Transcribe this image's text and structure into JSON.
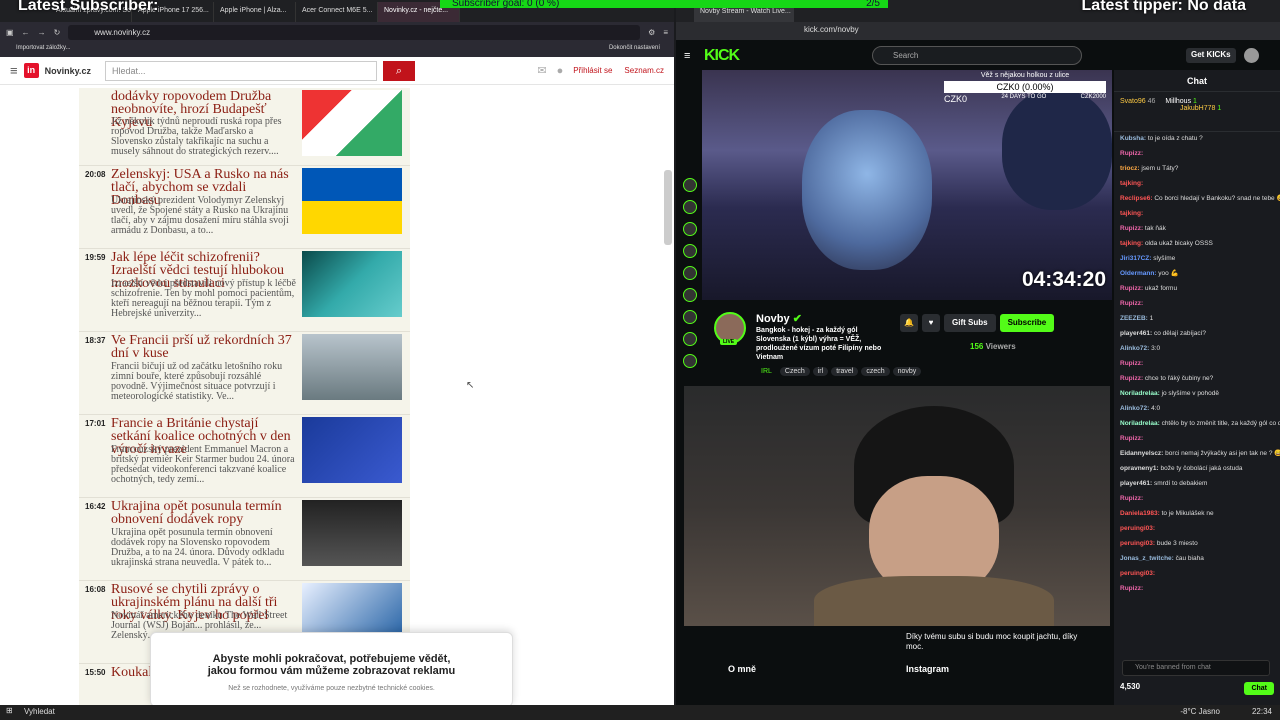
{
  "overlay": {
    "left": "Latest Subscriber:",
    "right": "Latest tipper: No data",
    "goal_text": "Subscriber goal:",
    "goal_pct": "0 (0 %)",
    "goal_count": "2/5"
  },
  "left_browser": {
    "tabs": [
      "Aktuální zprávy.com: Soul...",
      "Apple iPhone 17 256...",
      "Apple iPhone | Alza...",
      "Acer Connect M6E 5...",
      "Novinky.cz - nejčte..."
    ],
    "url": "www.novinky.cz",
    "bookmark": "Importovat záložky...",
    "bookmark_right": "Dokončit nastavení",
    "site": {
      "name": "Novinky.cz",
      "search_placeholder": "Hledat...",
      "login": "Přihlásit se",
      "brand": "Seznam.cz"
    },
    "articles": [
      {
        "time": "",
        "title": "dodávky ropovodem Družba neobnovíte, hrozí Budapešť Kyjevu",
        "perex": "Již několik týdnů neproudí ruská ropa přes ropovod Družba, takže Maďarsko a Slovensko zůstaly takřikajíc na suchu a musely sáhnout do strategických rezerv...."
      },
      {
        "time": "20:08",
        "title": "Zelenskyj: USA a Rusko na nás tlačí, abychom se vzdali Donbasu",
        "perex": "Ukrajinský prezident Volodymyr Zelenskyj uvedl, že Spojené státy a Rusko na Ukrajinu tlačí, aby v zájmu dosažení míru stáhla svoji armádu z Donbasu, a to..."
      },
      {
        "time": "19:59",
        "title": "Jak lépe léčit schizofrenii? Izraelští vědci testují hlubokou mozkovou stimulaci",
        "perex": "Izraelští vědci představili nový přístup k léčbě schizofrenie. Ten by mohl pomoci pacientům, kteří nereagují na běžnou terapii. Tým z Hebrejské univerzity..."
      },
      {
        "time": "18:37",
        "title": "Ve Francii prší už rekordních 37 dní v kuse",
        "perex": "Francii bičují už od začátku letošního roku zimní bouře, které způsobují rozsáhlé povodně. Výjimečnost situace potvrzují i meteorologické statistiky. Ve..."
      },
      {
        "time": "17:01",
        "title": "Francie a Británie chystají setkání koalice ochotných v den výročí invaze",
        "perex": "Francouzský prezident Emmanuel Macron a britský premiér Keir Starmer budou 24. února předsedat videokonferenci takzvané koalice ochotných, tedy zemí..."
      },
      {
        "time": "16:42",
        "title": "Ukrajina opět posunula termín obnovení dodávek ropy",
        "perex": "Ukrajina opět posunula termín obnovení dodávek ropy na Slovensko ropovodem Družba, a to na 24. února. Důvody odkladu ukrajinská strana neuvedla. V pátek to..."
      },
      {
        "time": "16:08",
        "title": "Rusové se chytili zprávy o ukrajinském plánu na další tři roky války. Kyjev ho popřel",
        "perex": "Novinář amerického deníku The Wall Street Journal (WSJ) Bojan... prohlásil, že... Zelenský..."
      },
      {
        "time": "15:50",
        "title": "Koukali n... zlomeni...",
        "perex": ""
      }
    ],
    "consent": {
      "main": "Abyste mohli pokračovat, potřebujeme vědět, jakou formou vám můžeme zobrazovat reklamu",
      "sub": "Než se rozhodnete, využíváme pouze nezbytné technické cookies."
    }
  },
  "right_browser": {
    "tab": "Novby Stream - Watch Live...",
    "url": "kick.com/novby",
    "kick": {
      "logo": "KICK",
      "search_placeholder": "Search",
      "get_kicks": "Get KICKs"
    },
    "video": {
      "goal_title": "Věž s nějakou holkou z ulice",
      "goal_value": "CZK0 (0.00%)",
      "goal_left": "CZK0",
      "goal_days": "24 DAYS TO GO",
      "goal_right": "CZK2000",
      "timer": "04:34:20"
    },
    "channel": {
      "name": "Novby",
      "title": "Bangkok - hokej - za každý gól Slovenska (1 kýbl) výhra = VĚŽ, prodloužené vízum poté Filipíny nebo Vietnam",
      "category": "IRL",
      "tags": [
        "Czech",
        "irl",
        "travel",
        "czech",
        "novby"
      ],
      "viewers": "156",
      "viewers_label": "Viewers",
      "gift_subs": "Gift Subs",
      "subscribe": "Subscribe",
      "live": "LIVE"
    },
    "below": {
      "quote": "Díky tvému subu si budu moc koupit jachtu, díky moc.",
      "about": "O mně",
      "instagram": "Instagram"
    },
    "chat": {
      "header": "Chat",
      "pinned": {
        "user1": "Svato96",
        "val1": "46",
        "user2": "Millhous",
        "val2": "1",
        "user3": "JakubH778",
        "val3": "1"
      },
      "messages": [
        {
          "user": "Kubsha:",
          "text": "to je oída z chatu ?",
          "color": "#9bd"
        },
        {
          "user": "Rupizz:",
          "text": "",
          "color": "#e6a"
        },
        {
          "user": "triocz:",
          "text": "jsem u Táty?",
          "color": "#fa4"
        },
        {
          "user": "tajking:",
          "text": "",
          "color": "#f55"
        },
        {
          "user": "Reclipse6:",
          "text": "Co borci hledají v Bankoku? snad ne tebe 😄😄",
          "color": "#f55"
        },
        {
          "user": "tajking:",
          "text": "",
          "color": "#f55"
        },
        {
          "user": "Rupizz:",
          "text": "tak ňák",
          "color": "#e6a"
        },
        {
          "user": "tajking:",
          "text": "olda ukaž bicaky OSSS",
          "color": "#f55"
        },
        {
          "user": "Jiri317CZ:",
          "text": "slyšíme",
          "color": "#69f"
        },
        {
          "user": "Oldermann:",
          "text": "yoo 💪",
          "color": "#69f"
        },
        {
          "user": "Rupizz:",
          "text": "ukaž formu",
          "color": "#e6a"
        },
        {
          "user": "Rupizz:",
          "text": "",
          "color": "#e6a"
        },
        {
          "user": "ZEEZEB:",
          "text": "1",
          "color": "#9bd"
        },
        {
          "user": "player461:",
          "text": "co dělají zabíjací?",
          "color": "#ddd"
        },
        {
          "user": "Alinko72:",
          "text": "3:0",
          "color": "#9bd"
        },
        {
          "user": "Rupizz:",
          "text": "",
          "color": "#e6a"
        },
        {
          "user": "Rupizz:",
          "text": "chce to řáký čubiny ne?",
          "color": "#e6a"
        },
        {
          "user": "Noriladrelaa:",
          "text": "jo slyšíme v pohodě",
          "color": "#9fc"
        },
        {
          "user": "Alinko72:",
          "text": "4:0",
          "color": "#9bd"
        },
        {
          "user": "Noriladrelaa:",
          "text": "chtělo by to změnit title, za každý gól co dostane slovensko piješ kýbl :D",
          "color": "#9fc"
        },
        {
          "user": "Rupizz:",
          "text": "",
          "color": "#e6a"
        },
        {
          "user": "Eidannyelscz:",
          "text": "borci nemaj žvýkačky asi jen tak ne ? 😄",
          "color": "#ddd"
        },
        {
          "user": "opravneny1:",
          "text": "bože ty čobolácí jaká ostuda",
          "color": "#ddd"
        },
        {
          "user": "player461:",
          "text": "smrdí to debakiem",
          "color": "#ddd"
        },
        {
          "user": "Rupizz:",
          "text": "",
          "color": "#e6a"
        },
        {
          "user": "Daniela1983:",
          "text": "to je Mikulášek ne",
          "color": "#f55"
        },
        {
          "user": "peruingi03:",
          "text": "",
          "color": "#f55"
        },
        {
          "user": "peruingi03:",
          "text": "bude 3 miesto",
          "color": "#f55"
        },
        {
          "user": "Jonas_z_twitche:",
          "text": "čau biaha",
          "color": "#9bd"
        },
        {
          "user": "peruingi03:",
          "text": "",
          "color": "#f55"
        },
        {
          "user": "Rupizz:",
          "text": "",
          "color": "#e6a"
        }
      ],
      "input_placeholder": "You're banned from chat",
      "kicks": "4,530",
      "chat_button": "Chat"
    }
  },
  "taskbar": {
    "search": "Vyhledat",
    "weather": "-8°C  Jasno",
    "time": "22:34"
  }
}
